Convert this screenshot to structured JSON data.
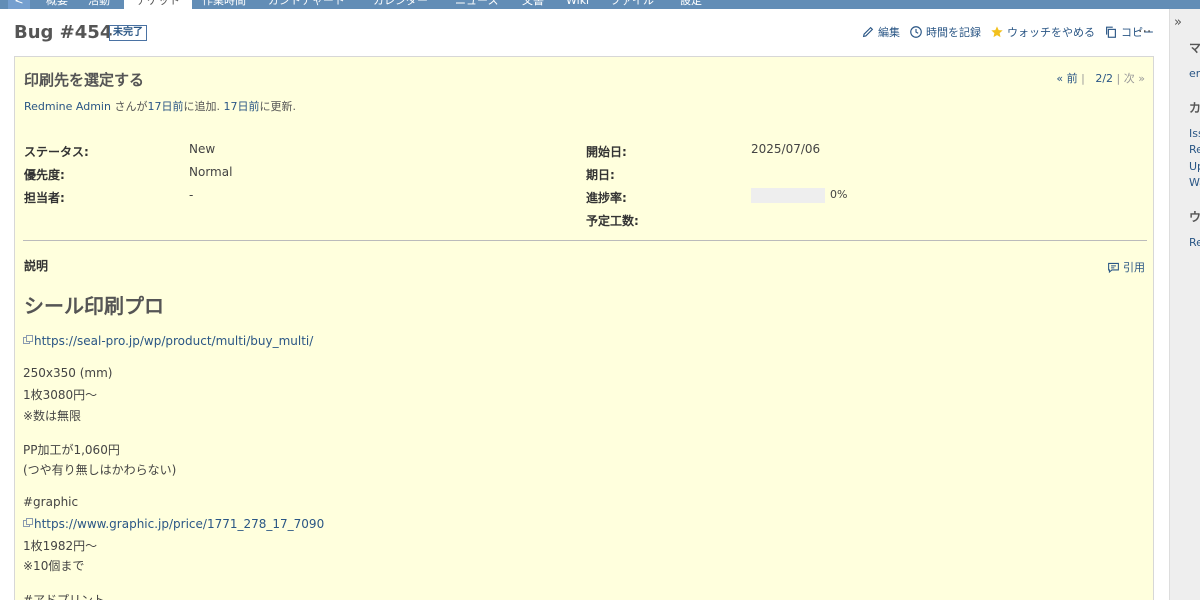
{
  "nav": {
    "tabs": [
      "<",
      "概要",
      "活動",
      "チケット",
      "作業時間",
      "ガントチャート",
      "カレンダー",
      "ニュース",
      "文書",
      "Wiki",
      "ファイル",
      "設定"
    ],
    "active_index": 3
  },
  "issue": {
    "title": "Bug #454",
    "status_badge": "未完了",
    "subject": "印刷先を選定する",
    "author_link": "Redmine Admin",
    "author_middle": " さんが",
    "added_link": "17日前",
    "added_text": "に追加. ",
    "updated_link": "17日前",
    "updated_text": "に更新."
  },
  "actions": {
    "edit": "編集",
    "log_time": "時間を記録",
    "unwatch": "ウォッチをやめる",
    "copy": "コピー",
    "more": "···"
  },
  "navigation": {
    "prev": "« 前",
    "sep1": "|",
    "position": "2/2",
    "sep2": "|",
    "next": "次 »"
  },
  "attributes": {
    "status_label": "ステータス:",
    "status_value": "New",
    "priority_label": "優先度:",
    "priority_value": "Normal",
    "assignee_label": "担当者:",
    "assignee_value": "-",
    "start_label": "開始日:",
    "start_value": "2025/07/06",
    "due_label": "期日:",
    "progress_label": "進捗率:",
    "progress_value": 0,
    "progress_text": "0%",
    "estimate_label": "予定工数:"
  },
  "description": {
    "label": "説明",
    "quote": "引用",
    "heading": "シール印刷プロ",
    "link1": "https://seal-pro.jp/wp/product/multi/buy_multi/",
    "line1": "250x350 (mm)",
    "line2": "1枚3080円〜",
    "line3": "※数は無限",
    "line4": "PP加工が1,060円",
    "line5": "(つや有り無しはかわらない)",
    "line6": "#graphic",
    "link2": "https://www.graphic.jp/price/1771_278_17_7090",
    "line7": "1枚1982円〜",
    "line8": "※10個まで",
    "line9": "#アドプリント"
  },
  "sidebar": {
    "toggle": "»",
    "h1": "マ",
    "l1": "en",
    "h2": "カ",
    "l2": "Iss",
    "l3": "Re",
    "l4": "Up",
    "l5": "Wa",
    "h3": "ウ",
    "l6": "Re"
  },
  "colors": {
    "nav_bg": "#628db6",
    "issue_bg": "#ffffdd",
    "link": "#2a5685",
    "watch_star": "#f2c01d"
  }
}
